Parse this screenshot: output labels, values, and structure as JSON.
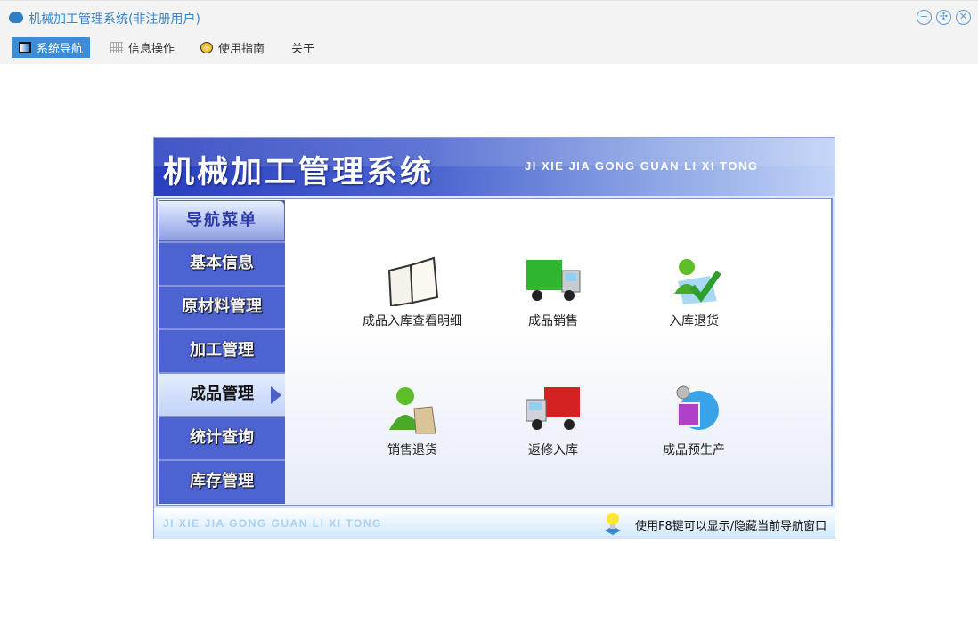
{
  "window": {
    "title": "机械加工管理系统(非注册用户)",
    "controls": [
      "minimize",
      "maximize",
      "close"
    ]
  },
  "menubar": [
    {
      "label": "系统导航",
      "icon": "monitor-icon"
    },
    {
      "label": "信息操作",
      "icon": "grid-icon"
    },
    {
      "label": "使用指南",
      "icon": "help-icon"
    },
    {
      "label": "关于"
    }
  ],
  "header": {
    "title": "机械加工管理系统",
    "pinyin": "JI XIE JIA GONG GUAN LI XI TONG"
  },
  "sidebar": {
    "heading": "导航菜单",
    "items": [
      {
        "label": "基本信息"
      },
      {
        "label": "原材料管理"
      },
      {
        "label": "加工管理"
      },
      {
        "label": "成品管理",
        "selected": true
      },
      {
        "label": "统计查询"
      },
      {
        "label": "库存管理"
      }
    ]
  },
  "tiles": [
    {
      "label": "成品入库查看明细",
      "icon": "folder-book-icon"
    },
    {
      "label": "成品销售",
      "icon": "green-truck-icon"
    },
    {
      "label": "入库退货",
      "icon": "user-check-icon"
    },
    {
      "label": "销售退货",
      "icon": "user-bag-icon"
    },
    {
      "label": "返修入库",
      "icon": "red-truck-icon"
    },
    {
      "label": "成品预生产",
      "icon": "media-disc-icon"
    }
  ],
  "footer": {
    "pinyin": "JI XIE JIA GONG GUAN LI XI TONG",
    "hint": "使用F8键可以显示/隐藏当前导航窗口"
  }
}
